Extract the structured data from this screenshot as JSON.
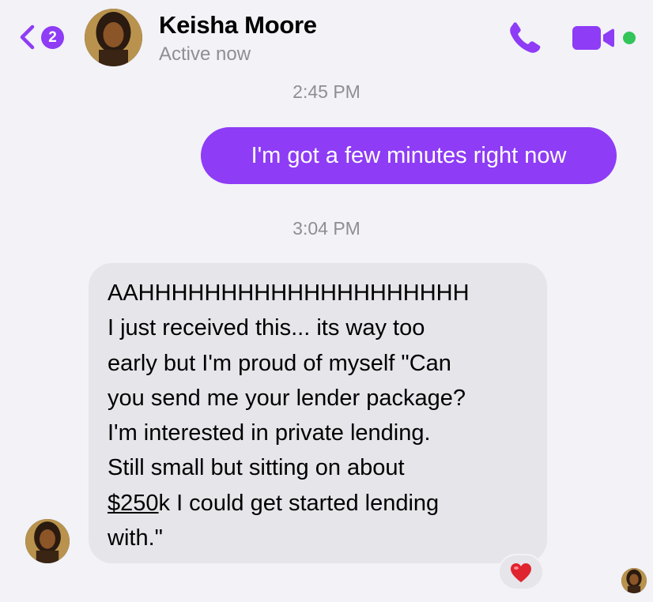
{
  "header": {
    "back_badge_count": "2",
    "contact_name": "Keisha Moore",
    "status": "Active now",
    "icons": {
      "back": "chevron-left-icon",
      "call": "phone-icon",
      "video": "video-camera-icon"
    },
    "online_indicator_color": "#31c55a",
    "accent_color": "#8e3cf5"
  },
  "messages": [
    {
      "timestamp": "2:45 PM",
      "direction": "outgoing",
      "text": "I'm got a few minutes right now"
    },
    {
      "timestamp": "3:04 PM",
      "direction": "incoming",
      "lines": [
        "AAHHHHHHHHHHHHHHHHHHHH",
        "I just received this... its way too",
        "early but I'm proud of myself \"Can",
        "you send me your lender package?",
        "I'm interested in private lending.",
        "Still small but sitting on about"
      ],
      "amount": "$250",
      "line_after_amount": "k I could get started lending",
      "last_line": "with.\"",
      "reaction": "❤️"
    }
  ]
}
